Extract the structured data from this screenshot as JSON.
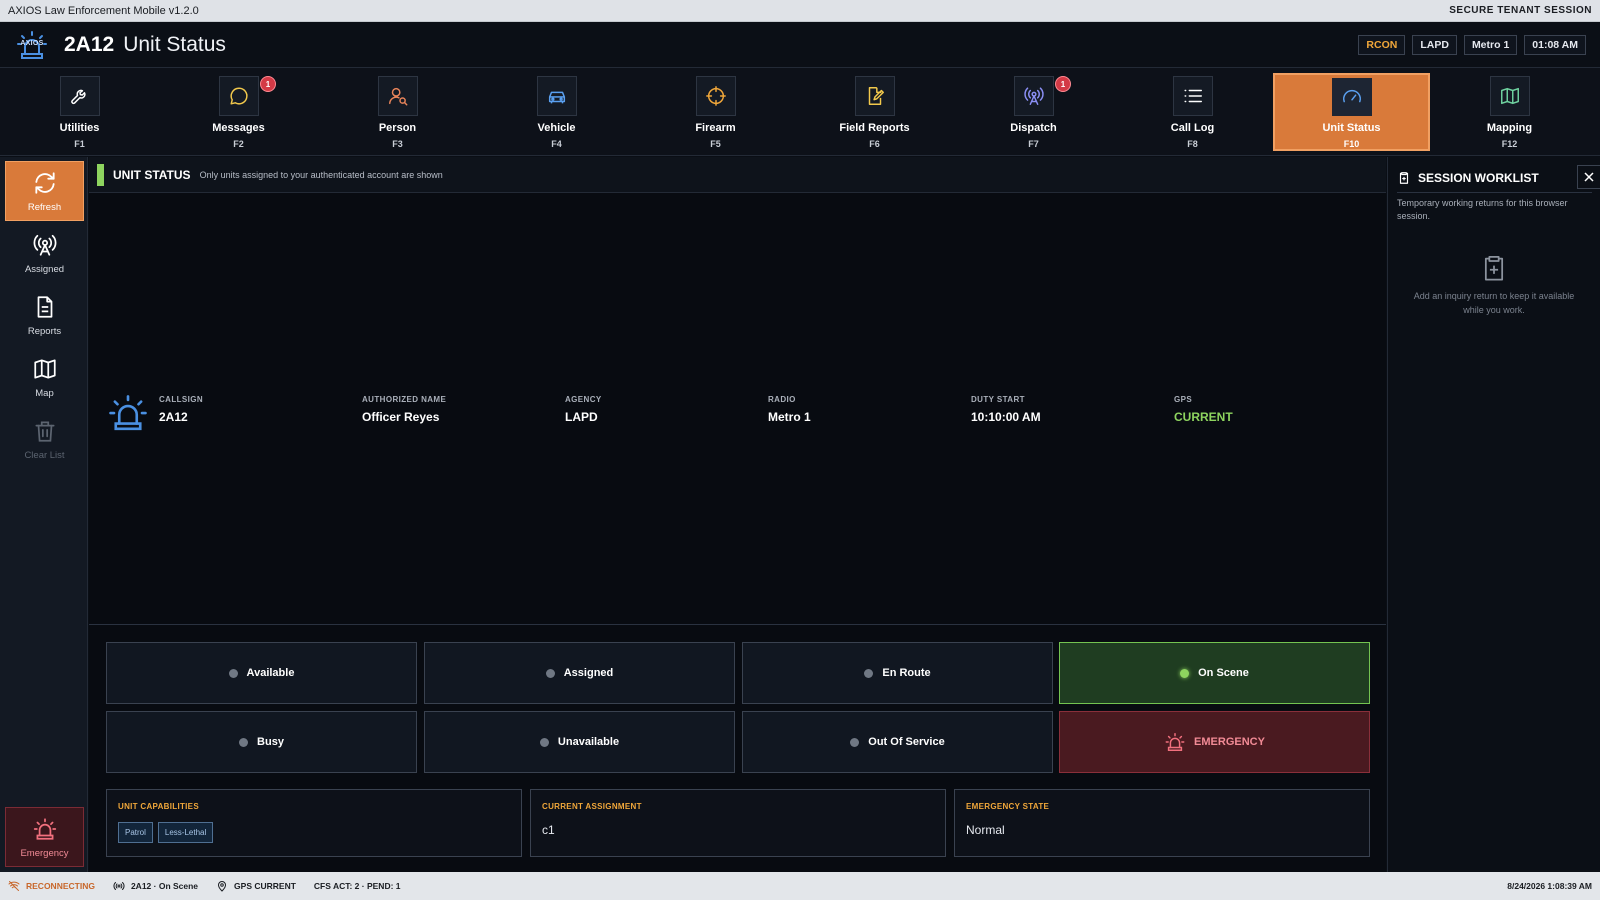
{
  "window": {
    "app_title": "AXIOS Law Enforcement Mobile v1.2.0",
    "session_label": "SECURE TENANT SESSION"
  },
  "header": {
    "logo_text": "AXIOS",
    "callsign": "2A12",
    "title": "Unit Status",
    "chips": {
      "rcon": "RCON",
      "agency": "LAPD",
      "radio": "Metro 1",
      "time": "01:08 AM"
    }
  },
  "nav": {
    "items": [
      {
        "label": "Utilities",
        "key": "F1",
        "icon": "wrench-icon"
      },
      {
        "label": "Messages",
        "key": "F2",
        "icon": "message-bubble-icon",
        "badge": "1"
      },
      {
        "label": "Person",
        "key": "F3",
        "icon": "person-search-icon"
      },
      {
        "label": "Vehicle",
        "key": "F4",
        "icon": "car-icon"
      },
      {
        "label": "Firearm",
        "key": "F5",
        "icon": "crosshair-icon"
      },
      {
        "label": "Field Reports",
        "key": "F6",
        "icon": "edit-document-icon"
      },
      {
        "label": "Dispatch",
        "key": "F7",
        "icon": "radio-tower-icon",
        "badge": "1"
      },
      {
        "label": "Call Log",
        "key": "F8",
        "icon": "list-icon"
      },
      {
        "label": "Unit Status",
        "key": "F10",
        "icon": "gauge-icon",
        "active": true
      },
      {
        "label": "Mapping",
        "key": "F12",
        "icon": "map-icon"
      }
    ]
  },
  "sidebar": {
    "refresh": "Refresh",
    "assigned": "Assigned",
    "reports": "Reports",
    "map": "Map",
    "clear_list": "Clear List",
    "emergency": "Emergency"
  },
  "panel": {
    "title": "UNIT STATUS",
    "subtitle": "Only units assigned to your authenticated account are shown"
  },
  "unit": {
    "callsign_label": "CALLSIGN",
    "callsign": "2A12",
    "name_label": "AUTHORIZED NAME",
    "name": "Officer Reyes",
    "agency_label": "AGENCY",
    "agency": "LAPD",
    "radio_label": "RADIO",
    "radio": "Metro 1",
    "duty_label": "DUTY START",
    "duty_start": "10:10:00 AM",
    "gps_label": "GPS",
    "gps": "CURRENT"
  },
  "statuses": {
    "available": "Available",
    "assigned": "Assigned",
    "en_route": "En Route",
    "on_scene": "On Scene",
    "busy": "Busy",
    "unavailable": "Unavailable",
    "out_of_service": "Out Of Service",
    "emergency": "EMERGENCY",
    "current": "On Scene"
  },
  "cards": {
    "capabilities_label": "UNIT CAPABILITIES",
    "capabilities": [
      "Patrol",
      "Less-Lethal"
    ],
    "assignment_label": "CURRENT ASSIGNMENT",
    "assignment": "c1",
    "emergency_label": "EMERGENCY STATE",
    "emergency_state": "Normal"
  },
  "worklist": {
    "title": "SESSION WORKLIST",
    "description": "Temporary working returns for this browser session.",
    "empty": "Add an inquiry return to keep it available while you work."
  },
  "statusbar": {
    "connection": "RECONNECTING",
    "unit": "2A12 · On Scene",
    "gps": "GPS CURRENT",
    "cfs": "CFS ACT: 2 · PEND: 1",
    "datetime": "8/24/2026 1:08:39 AM"
  },
  "colors": {
    "accent": "#d97a3a",
    "on_scene": "#8ed45f",
    "emergency": "#f28b96",
    "warning": "#f0a73a"
  }
}
